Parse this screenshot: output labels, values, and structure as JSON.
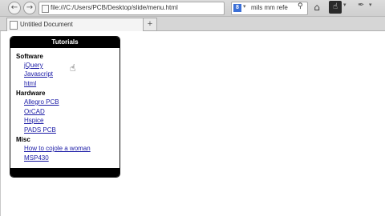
{
  "toolbar": {
    "back_icon": "back-arrow-icon",
    "forward_icon": "forward-arrow-icon",
    "back_glyph": "←",
    "forward_glyph": "→",
    "url": "file:///C:/Users/PCB/Desktop/slide/menu.html",
    "star_glyph": "☆",
    "reload_glyph": "⟳",
    "search_engine_badge": "8",
    "search_text": "mils mm refe",
    "search_glyph": "⚲",
    "home_glyph": "⌂",
    "hand_glyph": "☝",
    "dropdown_glyph": "▾",
    "tools_glyph": "✒"
  },
  "tabs": [
    {
      "label": "Untitled Document"
    }
  ],
  "new_tab_label": "+",
  "menu": {
    "title": "Tutorials",
    "categories": [
      {
        "name": "Software",
        "links": [
          "jQuery",
          "Javascript",
          "html"
        ]
      },
      {
        "name": "Hardware",
        "links": [
          "Allegro PCB",
          "OrCAD",
          "Hspice",
          "PADS PCB"
        ]
      },
      {
        "name": "Misc",
        "links": [
          "How to cojole a woman",
          "MSP430"
        ]
      }
    ]
  },
  "cursor_glyph": "☝",
  "colors": {
    "link": "#1a1aa6",
    "header_bg": "#000000",
    "header_text": "#ffffff"
  }
}
